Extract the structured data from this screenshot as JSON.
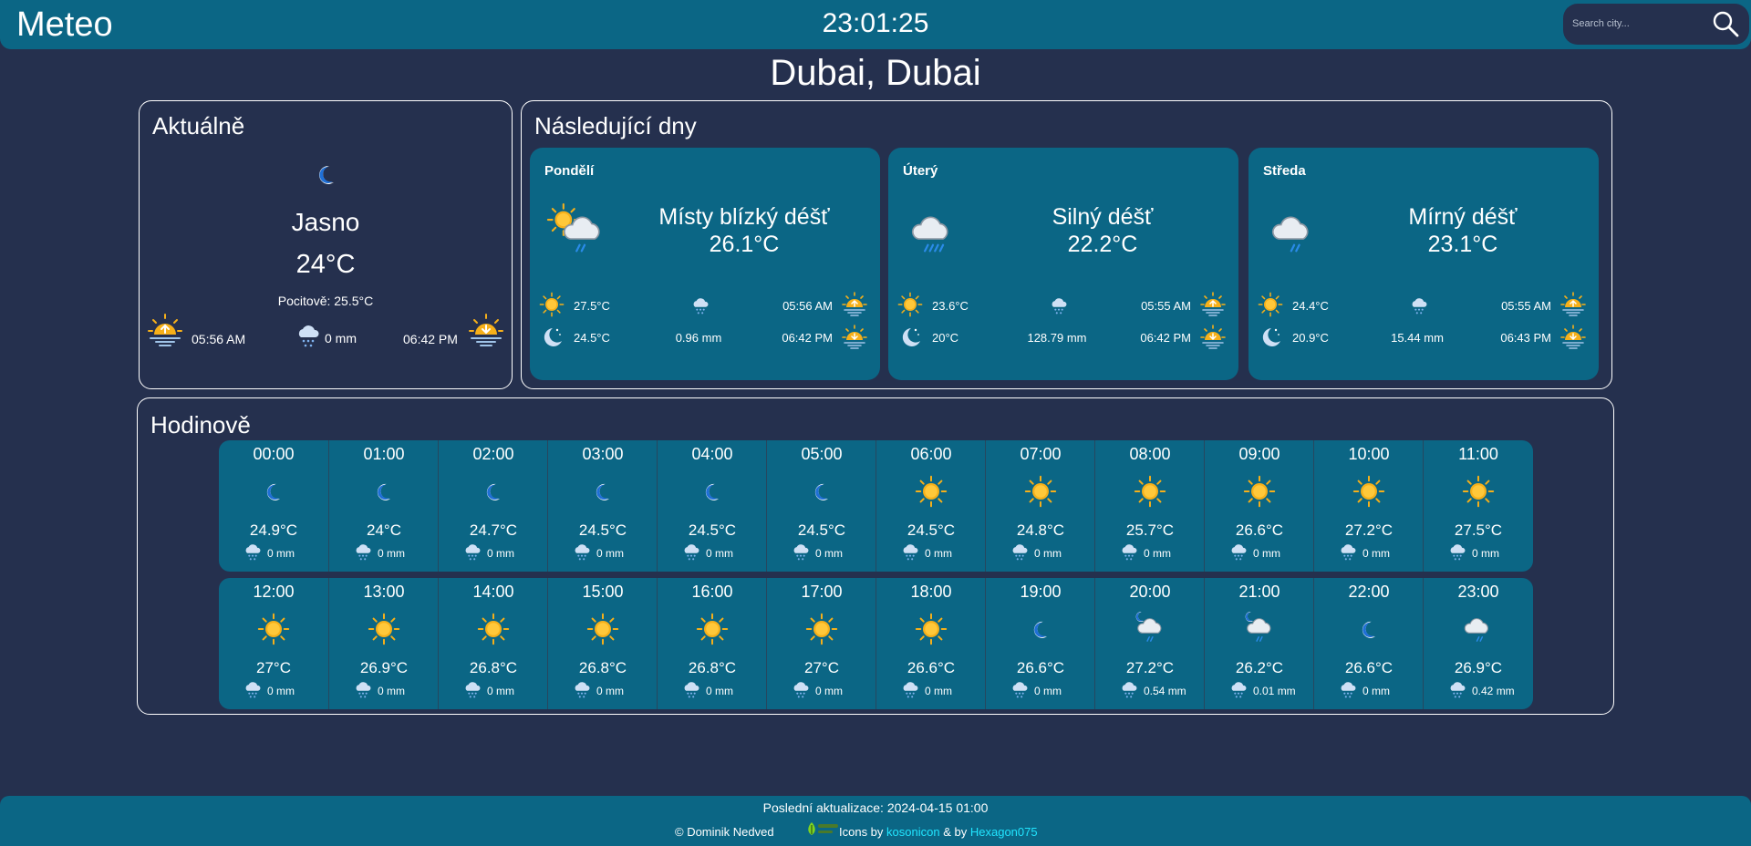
{
  "header": {
    "app_title": "Meteo",
    "clock": "23:01:25",
    "search_placeholder": "Search city..."
  },
  "location": "Dubai, Dubai",
  "current": {
    "title": "Aktuálně",
    "icon": "moon-icon",
    "condition": "Jasno",
    "temp": "24°C",
    "feels_like": "Pocitově: 25.5°C",
    "sunrise": "05:56 AM",
    "precip": "0 mm",
    "sunset": "06:42 PM"
  },
  "forecast": {
    "title": "Následující dny",
    "days": [
      {
        "name": "Pondělí",
        "icon": "sun-cloud-rain-icon",
        "condition": "Místy blízký déšť",
        "temp": "26.1°C",
        "max": "27.5°C",
        "min": "24.5°C",
        "precip": "0.96 mm",
        "sunrise": "05:56 AM",
        "sunset": "06:42 PM"
      },
      {
        "name": "Úterý",
        "icon": "cloud-heavy-rain-icon",
        "condition": "Silný déšť",
        "temp": "22.2°C",
        "max": "23.6°C",
        "min": "20°C",
        "precip": "128.79 mm",
        "sunrise": "05:55 AM",
        "sunset": "06:42 PM"
      },
      {
        "name": "Středa",
        "icon": "cloud-rain-icon",
        "condition": "Mírný déšť",
        "temp": "23.1°C",
        "max": "24.4°C",
        "min": "20.9°C",
        "precip": "15.44 mm",
        "sunrise": "05:55 AM",
        "sunset": "06:43 PM"
      }
    ]
  },
  "hourly": {
    "title": "Hodinově",
    "hours": [
      {
        "time": "00:00",
        "icon": "moon",
        "temp": "24.9°C",
        "precip": "0 mm"
      },
      {
        "time": "01:00",
        "icon": "moon",
        "temp": "24°C",
        "precip": "0 mm"
      },
      {
        "time": "02:00",
        "icon": "moon",
        "temp": "24.7°C",
        "precip": "0 mm"
      },
      {
        "time": "03:00",
        "icon": "moon",
        "temp": "24.5°C",
        "precip": "0 mm"
      },
      {
        "time": "04:00",
        "icon": "moon",
        "temp": "24.5°C",
        "precip": "0 mm"
      },
      {
        "time": "05:00",
        "icon": "moon",
        "temp": "24.5°C",
        "precip": "0 mm"
      },
      {
        "time": "06:00",
        "icon": "sun",
        "temp": "24.5°C",
        "precip": "0 mm"
      },
      {
        "time": "07:00",
        "icon": "sun",
        "temp": "24.8°C",
        "precip": "0 mm"
      },
      {
        "time": "08:00",
        "icon": "sun",
        "temp": "25.7°C",
        "precip": "0 mm"
      },
      {
        "time": "09:00",
        "icon": "sun",
        "temp": "26.6°C",
        "precip": "0 mm"
      },
      {
        "time": "10:00",
        "icon": "sun",
        "temp": "27.2°C",
        "precip": "0 mm"
      },
      {
        "time": "11:00",
        "icon": "sun",
        "temp": "27.5°C",
        "precip": "0 mm"
      },
      {
        "time": "12:00",
        "icon": "sun",
        "temp": "27°C",
        "precip": "0 mm"
      },
      {
        "time": "13:00",
        "icon": "sun",
        "temp": "26.9°C",
        "precip": "0 mm"
      },
      {
        "time": "14:00",
        "icon": "sun",
        "temp": "26.8°C",
        "precip": "0 mm"
      },
      {
        "time": "15:00",
        "icon": "sun",
        "temp": "26.8°C",
        "precip": "0 mm"
      },
      {
        "time": "16:00",
        "icon": "sun",
        "temp": "26.8°C",
        "precip": "0 mm"
      },
      {
        "time": "17:00",
        "icon": "sun",
        "temp": "27°C",
        "precip": "0 mm"
      },
      {
        "time": "18:00",
        "icon": "sun",
        "temp": "26.6°C",
        "precip": "0 mm"
      },
      {
        "time": "19:00",
        "icon": "moon",
        "temp": "26.6°C",
        "precip": "0 mm"
      },
      {
        "time": "20:00",
        "icon": "moon-cloud-rain",
        "temp": "27.2°C",
        "precip": "0.54 mm"
      },
      {
        "time": "21:00",
        "icon": "moon-cloud-rain",
        "temp": "26.2°C",
        "precip": "0.01 mm"
      },
      {
        "time": "22:00",
        "icon": "moon",
        "temp": "26.6°C",
        "precip": "0 mm"
      },
      {
        "time": "23:00",
        "icon": "cloud-rain",
        "temp": "26.9°C",
        "precip": "0.42 mm"
      }
    ]
  },
  "footer": {
    "last_update": "Poslední aktualizace: 2024-04-15 01:00",
    "copyright": "© Dominik Nedved",
    "icons_by": "Icons by",
    "author1": "kosonicon",
    "and_by": "& by",
    "author2": "Hexagon075"
  },
  "colors": {
    "background": "#25304e",
    "card": "#0b6685",
    "link": "#21e5ff",
    "sun": "#f6b01a"
  }
}
